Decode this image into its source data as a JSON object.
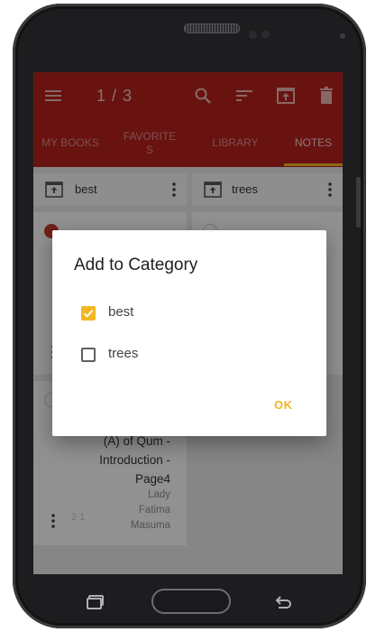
{
  "toolbar": {
    "counter": "1 / 3",
    "icons": [
      "menu-icon",
      "search-icon",
      "sort-icon",
      "move-to-category-icon",
      "delete-icon"
    ],
    "background_color": "#b3221d"
  },
  "tabs": [
    {
      "label": "MY BOOKS",
      "active": false
    },
    {
      "label": "FAVORITE S",
      "active": false
    },
    {
      "label": "LIBRARY",
      "active": false
    },
    {
      "label": "NOTES",
      "active": true
    }
  ],
  "categories": [
    {
      "label": "best"
    },
    {
      "label": "trees"
    }
  ],
  "cards": [
    {
      "title": "(A) of Qum - Introduction - Page4",
      "author": "Lady Fatima Masuma",
      "sort_badge": "2 1"
    }
  ],
  "dialog": {
    "title": "Add to Category",
    "options": [
      {
        "label": "best",
        "checked": true
      },
      {
        "label": "trees",
        "checked": false
      }
    ],
    "ok_label": "OK",
    "accent_color": "#f2b620"
  }
}
